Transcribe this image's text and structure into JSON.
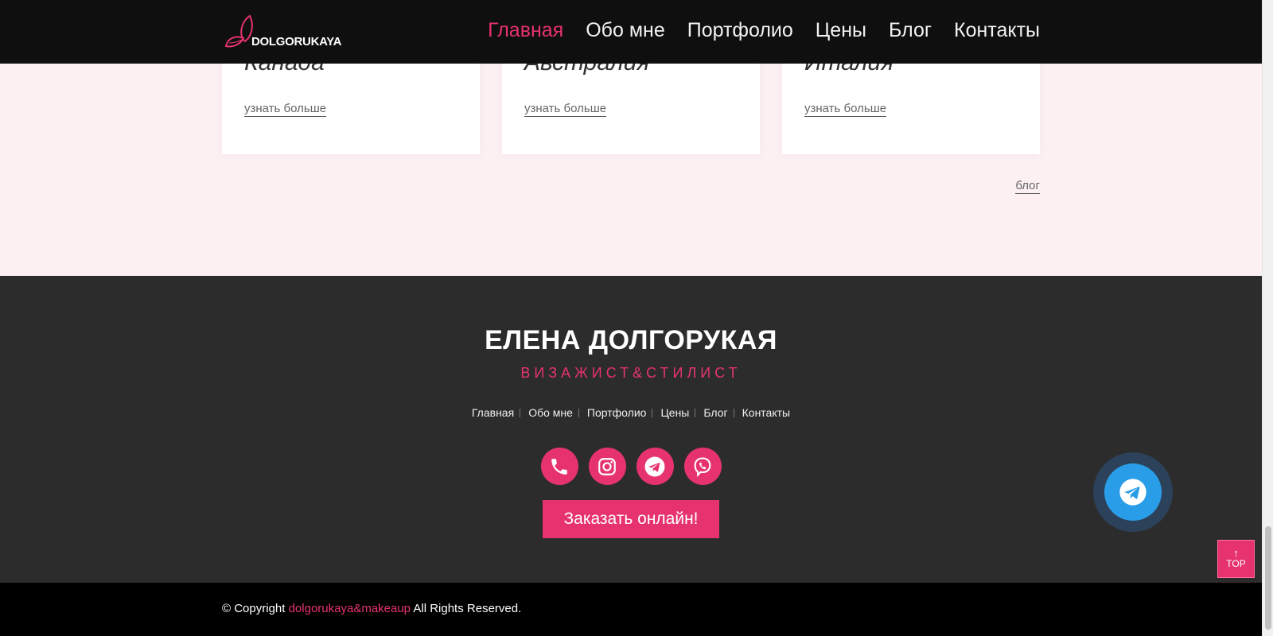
{
  "header": {
    "logo_text": "DOLGORUKAYA",
    "nav": [
      {
        "label": "Главная",
        "active": true
      },
      {
        "label": "Обо мне",
        "active": false
      },
      {
        "label": "Портфолио",
        "active": false
      },
      {
        "label": "Цены",
        "active": false
      },
      {
        "label": "Блог",
        "active": false
      },
      {
        "label": "Контакты",
        "active": false
      }
    ]
  },
  "blog": {
    "cards": [
      {
        "title": "Канада",
        "more": "узнать больше"
      },
      {
        "title": "Австралия",
        "more": "узнать больше"
      },
      {
        "title": "Италия",
        "more": "узнать больше"
      }
    ],
    "all_link": "блог"
  },
  "footer": {
    "name": "ЕЛЕНА ДОЛГОРУКАЯ",
    "subtitle": "ВИЗАЖИСТ&СТИЛИСТ",
    "nav": [
      "Главная",
      "Обо мне",
      "Портфолио",
      "Цены",
      "Блог",
      "Контакты"
    ],
    "socials": [
      "phone-icon",
      "instagram-icon",
      "telegram-icon",
      "viber-icon"
    ],
    "order_button": "Заказать онлайн!"
  },
  "bottom": {
    "copy_prefix": "© Copyright",
    "brand": "dolgorukaya&makeaup",
    "copy_suffix": "All Rights Reserved."
  },
  "floating": {
    "top_label": "TOP",
    "top_arrow": "↑"
  },
  "colors": {
    "accent": "#e6336f",
    "header_bg": "#0f0f0f",
    "footer_bg": "#2c2c2c",
    "telegram": "#2a9de8"
  }
}
